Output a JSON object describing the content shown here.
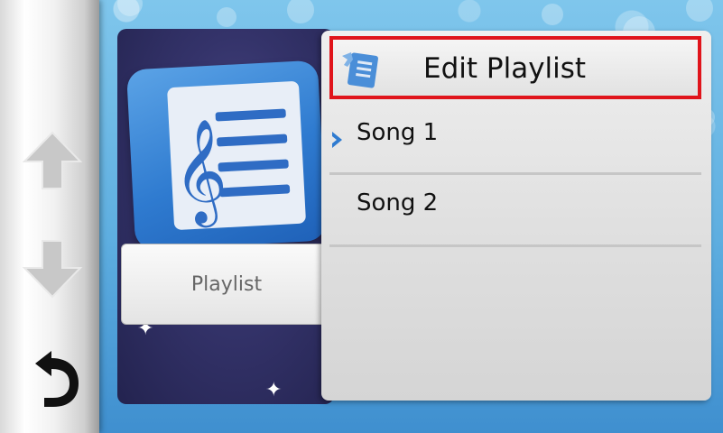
{
  "sidebar": {
    "up_icon": "arrow-up-icon",
    "down_icon": "arrow-down-icon",
    "back_icon": "back-arrow-icon"
  },
  "left_card": {
    "icon": "music-playlist-icon",
    "label": "Playlist"
  },
  "menu": {
    "edit": {
      "label": "Edit Playlist",
      "icon": "edit-playlist-icon",
      "highlight_color": "#e0141b"
    },
    "items": [
      {
        "label": "Song 1",
        "selected": true
      },
      {
        "label": "Song 2",
        "selected": false
      }
    ]
  },
  "colors": {
    "accent": "#2f7bd0",
    "chevron": "#2f7bd0"
  }
}
